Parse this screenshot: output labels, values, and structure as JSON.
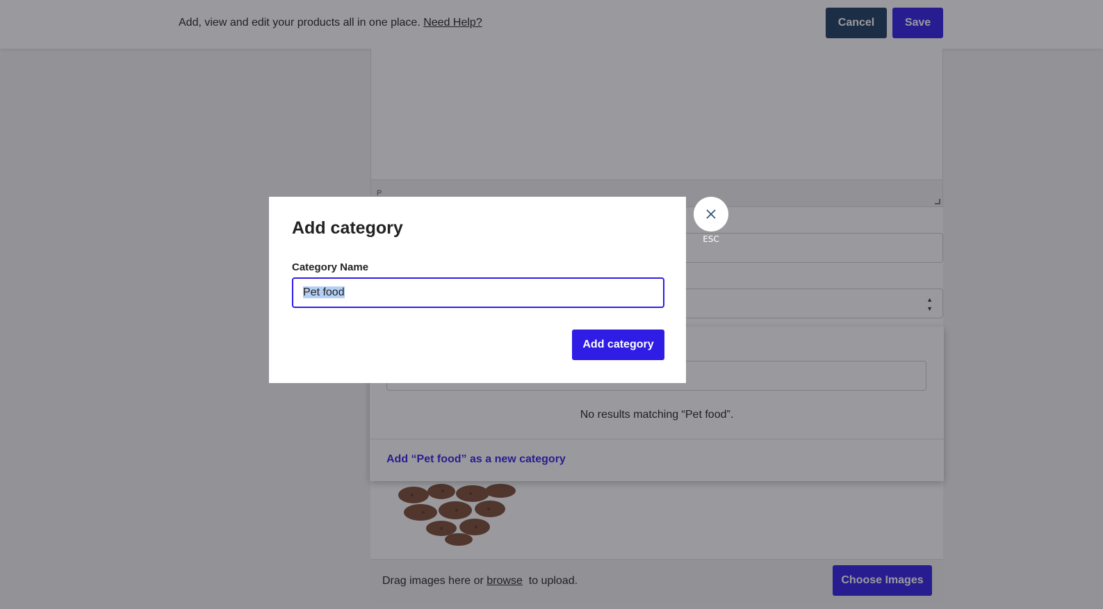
{
  "header": {
    "info_text": "Add, view and edit your products all in one place.",
    "help_link": "Need Help?",
    "cancel_label": "Cancel",
    "save_label": "Save"
  },
  "editor": {
    "status_text": "P"
  },
  "dropdown": {
    "no_results": "No results matching “Pet food”.",
    "add_new_label": "Add “Pet food” as a new category"
  },
  "upload": {
    "drag_text": "Drag images here or",
    "browse_link": "browse",
    "to_upload": "to upload.",
    "choose_label": "Choose Images"
  },
  "modal": {
    "title": "Add category",
    "field_label": "Category Name",
    "field_value": "Pet food",
    "submit_label": "Add category",
    "esc_label": "ESC"
  },
  "colors": {
    "primary": "#2f1de6",
    "dark_button": "#1b3a60"
  },
  "icons": {
    "close": "close-icon",
    "select_arrows": "updown-arrows-icon",
    "product_image": "dog-biscuits-image"
  }
}
